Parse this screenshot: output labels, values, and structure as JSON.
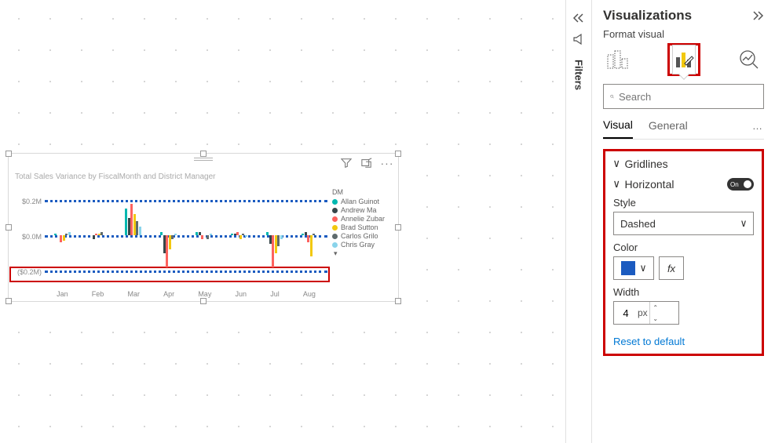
{
  "filters": {
    "label": "Filters"
  },
  "panel": {
    "title": "Visualizations",
    "subtitle": "Format visual",
    "search_placeholder": "Search",
    "tabs": {
      "visual": "Visual",
      "general": "General",
      "more": "…"
    }
  },
  "section": {
    "gridlines": "Gridlines",
    "horizontal": "Horizontal",
    "toggle": "On",
    "style_label": "Style",
    "style_value": "Dashed",
    "color_label": "Color",
    "color_value": "#1b5bc0",
    "fx": "fx",
    "width_label": "Width",
    "width_value": "4",
    "width_unit": "px",
    "reset": "Reset to default"
  },
  "chart": {
    "title": "Total Sales Variance by FiscalMonth and District Manager",
    "legend_title": "DM",
    "y_ticks": [
      "$0.2M",
      "$0.0M",
      "($0.2M)"
    ],
    "x_ticks": [
      "Jan",
      "Feb",
      "Mar",
      "Apr",
      "May",
      "Jun",
      "Jul",
      "Aug"
    ],
    "legend": [
      {
        "name": "Allan Guinot",
        "color": "#00b8b0"
      },
      {
        "name": "Andrew Ma",
        "color": "#374649"
      },
      {
        "name": "Annelie Zubar",
        "color": "#fd625e"
      },
      {
        "name": "Brad Sutton",
        "color": "#f2c80f"
      },
      {
        "name": "Carlos Grilo",
        "color": "#5f6b6d"
      },
      {
        "name": "Chris Gray",
        "color": "#8ad4eb"
      }
    ]
  },
  "chart_data": {
    "type": "bar",
    "title": "Total Sales Variance by FiscalMonth and District Manager",
    "xlabel": "FiscalMonth",
    "ylabel": "Total Sales Variance",
    "ylim": [
      -0.2,
      0.2
    ],
    "y_unit": "$M",
    "categories": [
      "Jan",
      "Feb",
      "Mar",
      "Apr",
      "May",
      "Jun",
      "Jul",
      "Aug"
    ],
    "series": [
      {
        "name": "Allan Guinot",
        "color": "#00b8b0",
        "values": [
          0.01,
          0.0,
          0.15,
          0.02,
          0.02,
          0.01,
          0.02,
          0.01
        ]
      },
      {
        "name": "Andrew Ma",
        "color": "#374649",
        "values": [
          0.0,
          -0.02,
          0.1,
          -0.1,
          0.02,
          0.01,
          -0.05,
          0.02
        ]
      },
      {
        "name": "Annelie Zubar",
        "color": "#fd625e",
        "values": [
          -0.04,
          0.01,
          0.18,
          -0.18,
          -0.02,
          0.02,
          -0.18,
          -0.04
        ]
      },
      {
        "name": "Brad Sutton",
        "color": "#f2c80f",
        "values": [
          -0.03,
          0.01,
          0.12,
          -0.08,
          0.0,
          -0.02,
          -0.1,
          -0.12
        ]
      },
      {
        "name": "Carlos Grilo",
        "color": "#5f6b6d",
        "values": [
          0.01,
          0.02,
          0.08,
          -0.02,
          -0.02,
          0.01,
          -0.06,
          0.01
        ]
      },
      {
        "name": "Chris Gray",
        "color": "#8ad4eb",
        "values": [
          0.02,
          0.0,
          0.05,
          0.01,
          0.01,
          -0.01,
          -0.02,
          0.0
        ]
      }
    ],
    "gridlines": {
      "orientation": "horizontal",
      "style": "dashed",
      "color": "#1b5bc0",
      "width": 4
    }
  }
}
